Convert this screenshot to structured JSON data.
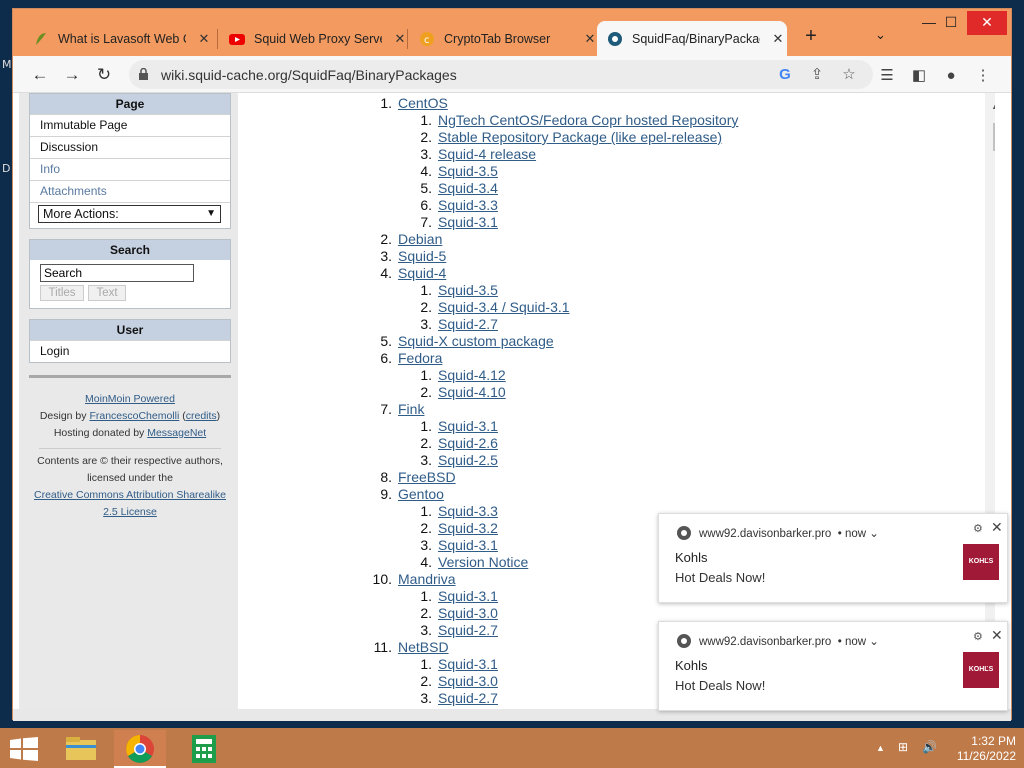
{
  "desktop": {
    "left_glyph_1": "M",
    "left_glyph_2": "D"
  },
  "browser": {
    "tabs": [
      {
        "title": "What is Lavasoft Web Co",
        "icon": "lavasoft-icon"
      },
      {
        "title": "Squid Web Proxy Server",
        "icon": "youtube-icon"
      },
      {
        "title": "CryptoTab Browser",
        "icon": "cryptotab-icon"
      },
      {
        "title": "SquidFaq/BinaryPackag",
        "icon": "squid-icon",
        "active": true
      }
    ],
    "close_glyph": "✕",
    "new_tab_glyph": "+",
    "tab_list_glyph": "⌄",
    "window_controls": {
      "minimize": "—",
      "maximize": "☐",
      "close": "✕"
    },
    "nav": {
      "back": "←",
      "forward": "→",
      "reload": "↻"
    },
    "url": "wiki.squid-cache.org/SquidFaq/BinaryPackages",
    "omnibox_icons": {
      "google": "G",
      "share": "⇪",
      "bookmark": "☆"
    },
    "toolbar_icons": {
      "reading_list": "☰",
      "side_panel": "◧",
      "profile": "●",
      "menu": "⋮"
    }
  },
  "sidebar": {
    "page_panel": {
      "header": "Page",
      "items": [
        "Immutable Page",
        "Discussion",
        "Info",
        "Attachments"
      ],
      "more_actions": "More Actions:"
    },
    "search_panel": {
      "header": "Search",
      "input_value": "Search",
      "titles_btn": "Titles",
      "text_btn": "Text"
    },
    "user_panel": {
      "header": "User",
      "login": "Login"
    },
    "footer": {
      "moinmoin": "MoinMoin Powered",
      "design_prefix": "Design by ",
      "designer": "FrancescoChemolli",
      "credits_open": " (",
      "credits": "credits",
      "credits_close": ")",
      "hosting_prefix": "Hosting donated by ",
      "host": "MessageNet",
      "contents_line1": "Contents are © their respective authors,",
      "contents_line2": "licensed under the",
      "license_line1": "Creative Commons Attribution Sharealike",
      "license_line2": "2.5 License"
    }
  },
  "main": {
    "items": [
      {
        "n": "1.",
        "t": "CentOS",
        "lvl": 1
      },
      {
        "n": "1.",
        "t": "NgTech CentOS/Fedora Copr hosted Repository",
        "lvl": 2
      },
      {
        "n": "2.",
        "t": "Stable Repository Package (like epel-release)",
        "lvl": 2
      },
      {
        "n": "3.",
        "t": "Squid-4 release",
        "lvl": 2
      },
      {
        "n": "4.",
        "t": "Squid-3.5",
        "lvl": 2
      },
      {
        "n": "5.",
        "t": "Squid-3.4",
        "lvl": 2
      },
      {
        "n": "6.",
        "t": "Squid-3.3",
        "lvl": 2
      },
      {
        "n": "7.",
        "t": "Squid-3.1",
        "lvl": 2
      },
      {
        "n": "2.",
        "t": "Debian",
        "lvl": 1
      },
      {
        "n": "3.",
        "t": "Squid-5",
        "lvl": 1
      },
      {
        "n": "4.",
        "t": "Squid-4",
        "lvl": 1
      },
      {
        "n": "1.",
        "t": "Squid-3.5",
        "lvl": 2
      },
      {
        "n": "2.",
        "t": "Squid-3.4 / Squid-3.1",
        "lvl": 2
      },
      {
        "n": "3.",
        "t": "Squid-2.7",
        "lvl": 2
      },
      {
        "n": "5.",
        "t": "Squid-X custom package",
        "lvl": 1
      },
      {
        "n": "6.",
        "t": "Fedora",
        "lvl": 1
      },
      {
        "n": "1.",
        "t": "Squid-4.12",
        "lvl": 2
      },
      {
        "n": "2.",
        "t": "Squid-4.10",
        "lvl": 2
      },
      {
        "n": "7.",
        "t": "Fink",
        "lvl": 1
      },
      {
        "n": "1.",
        "t": "Squid-3.1",
        "lvl": 2
      },
      {
        "n": "2.",
        "t": "Squid-2.6",
        "lvl": 2
      },
      {
        "n": "3.",
        "t": "Squid-2.5",
        "lvl": 2
      },
      {
        "n": "8.",
        "t": "FreeBSD",
        "lvl": 1
      },
      {
        "n": "9.",
        "t": "Gentoo",
        "lvl": 1
      },
      {
        "n": "1.",
        "t": "Squid-3.3",
        "lvl": 2
      },
      {
        "n": "2.",
        "t": "Squid-3.2",
        "lvl": 2
      },
      {
        "n": "3.",
        "t": "Squid-3.1",
        "lvl": 2
      },
      {
        "n": "4.",
        "t": "Version Notice",
        "lvl": 2
      },
      {
        "n": "10.",
        "t": "Mandriva",
        "lvl": 1
      },
      {
        "n": "1.",
        "t": "Squid-3.1",
        "lvl": 2
      },
      {
        "n": "2.",
        "t": "Squid-3.0",
        "lvl": 2
      },
      {
        "n": "3.",
        "t": "Squid-2.7",
        "lvl": 2
      },
      {
        "n": "11.",
        "t": "NetBSD",
        "lvl": 1
      },
      {
        "n": "1.",
        "t": "Squid-3.1",
        "lvl": 2
      },
      {
        "n": "2.",
        "t": "Squid-3.0",
        "lvl": 2
      },
      {
        "n": "3.",
        "t": "Squid-2.7",
        "lvl": 2
      }
    ]
  },
  "notifications": [
    {
      "source": "www92.davisonbarker.pro",
      "when": "• now ⌄",
      "title": "Kohls",
      "body": "Hot Deals Now!",
      "logo": "KOHĽS"
    },
    {
      "source": "www92.davisonbarker.pro",
      "when": "• now ⌄",
      "title": "Kohls",
      "body": "Hot Deals Now!",
      "logo": "KOHĽS"
    }
  ],
  "taskbar": {
    "time": "1:32 PM",
    "date": "11/26/2022",
    "tray_up": "▲"
  },
  "colors": {
    "tabstrip": "#f29a5f",
    "link": "#305c88",
    "taskbar": "#bf7a4a",
    "kohls": "#a01a38"
  }
}
